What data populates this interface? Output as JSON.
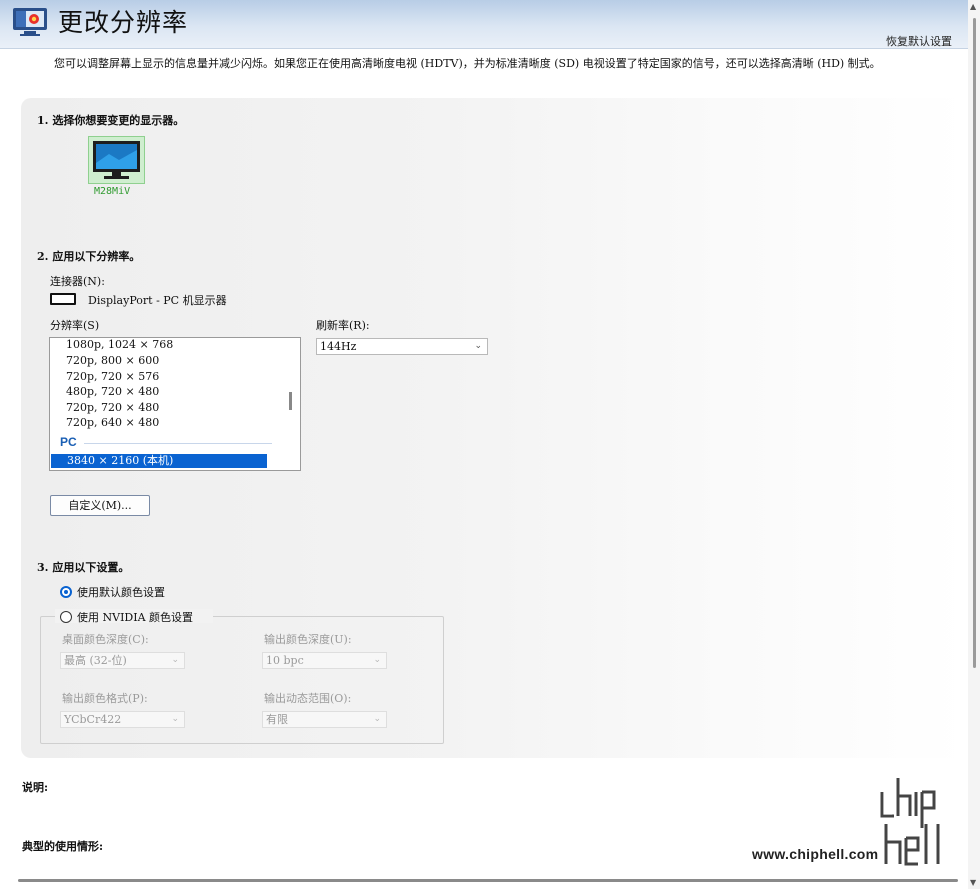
{
  "header": {
    "title": "更改分辨率",
    "restore_link": "恢复默认设置",
    "description": "您可以调整屏幕上显示的信息量并减少闪烁。如果您正在使用高清晰度电视 (HDTV)，并为标准清晰度 (SD) 电视设置了特定国家的信号，还可以选择高清晰 (HD) 制式。"
  },
  "section1": {
    "heading": "1. 选择你想要变更的显示器。",
    "display_name": "M28MiV"
  },
  "section2": {
    "heading": "2. 应用以下分辨率。",
    "connector_label": "连接器(N):",
    "connector_value": "DisplayPort - PC 机显示器",
    "resolution_label": "分辨率(S)",
    "resolutions": [
      "1080p, 1024 × 768",
      "720p, 800 × 600",
      "720p, 720 × 576",
      "480p, 720 × 480",
      "720p, 720 × 480",
      "720p, 640 × 480"
    ],
    "group_header": "PC",
    "selected_resolution": "3840 × 2160 (本机)",
    "refresh_label": "刷新率(R):",
    "refresh_value": "144Hz",
    "custom_button": "自定义(M)..."
  },
  "section3": {
    "heading": "3. 应用以下设置。",
    "radio_default": "使用默认颜色设置",
    "radio_nvidia": "使用 NVIDIA 颜色设置",
    "selected_option": "default",
    "desktop_depth_label": "桌面颜色深度(C):",
    "desktop_depth_value": "最高 (32-位)",
    "output_depth_label": "输出颜色深度(U):",
    "output_depth_value": "10 bpc",
    "output_format_label": "输出颜色格式(P):",
    "output_format_value": "YCbCr422",
    "output_range_label": "输出动态范围(O):",
    "output_range_value": "有限"
  },
  "footer": {
    "explanation_label": "说明:",
    "usage_label": "典型的使用情形:"
  },
  "watermark": {
    "site": "www.chiphell.com"
  },
  "colors": {
    "accent": "#0a63d1",
    "display_green": "#2e9a2e",
    "header_blue": "#b8cde6"
  }
}
